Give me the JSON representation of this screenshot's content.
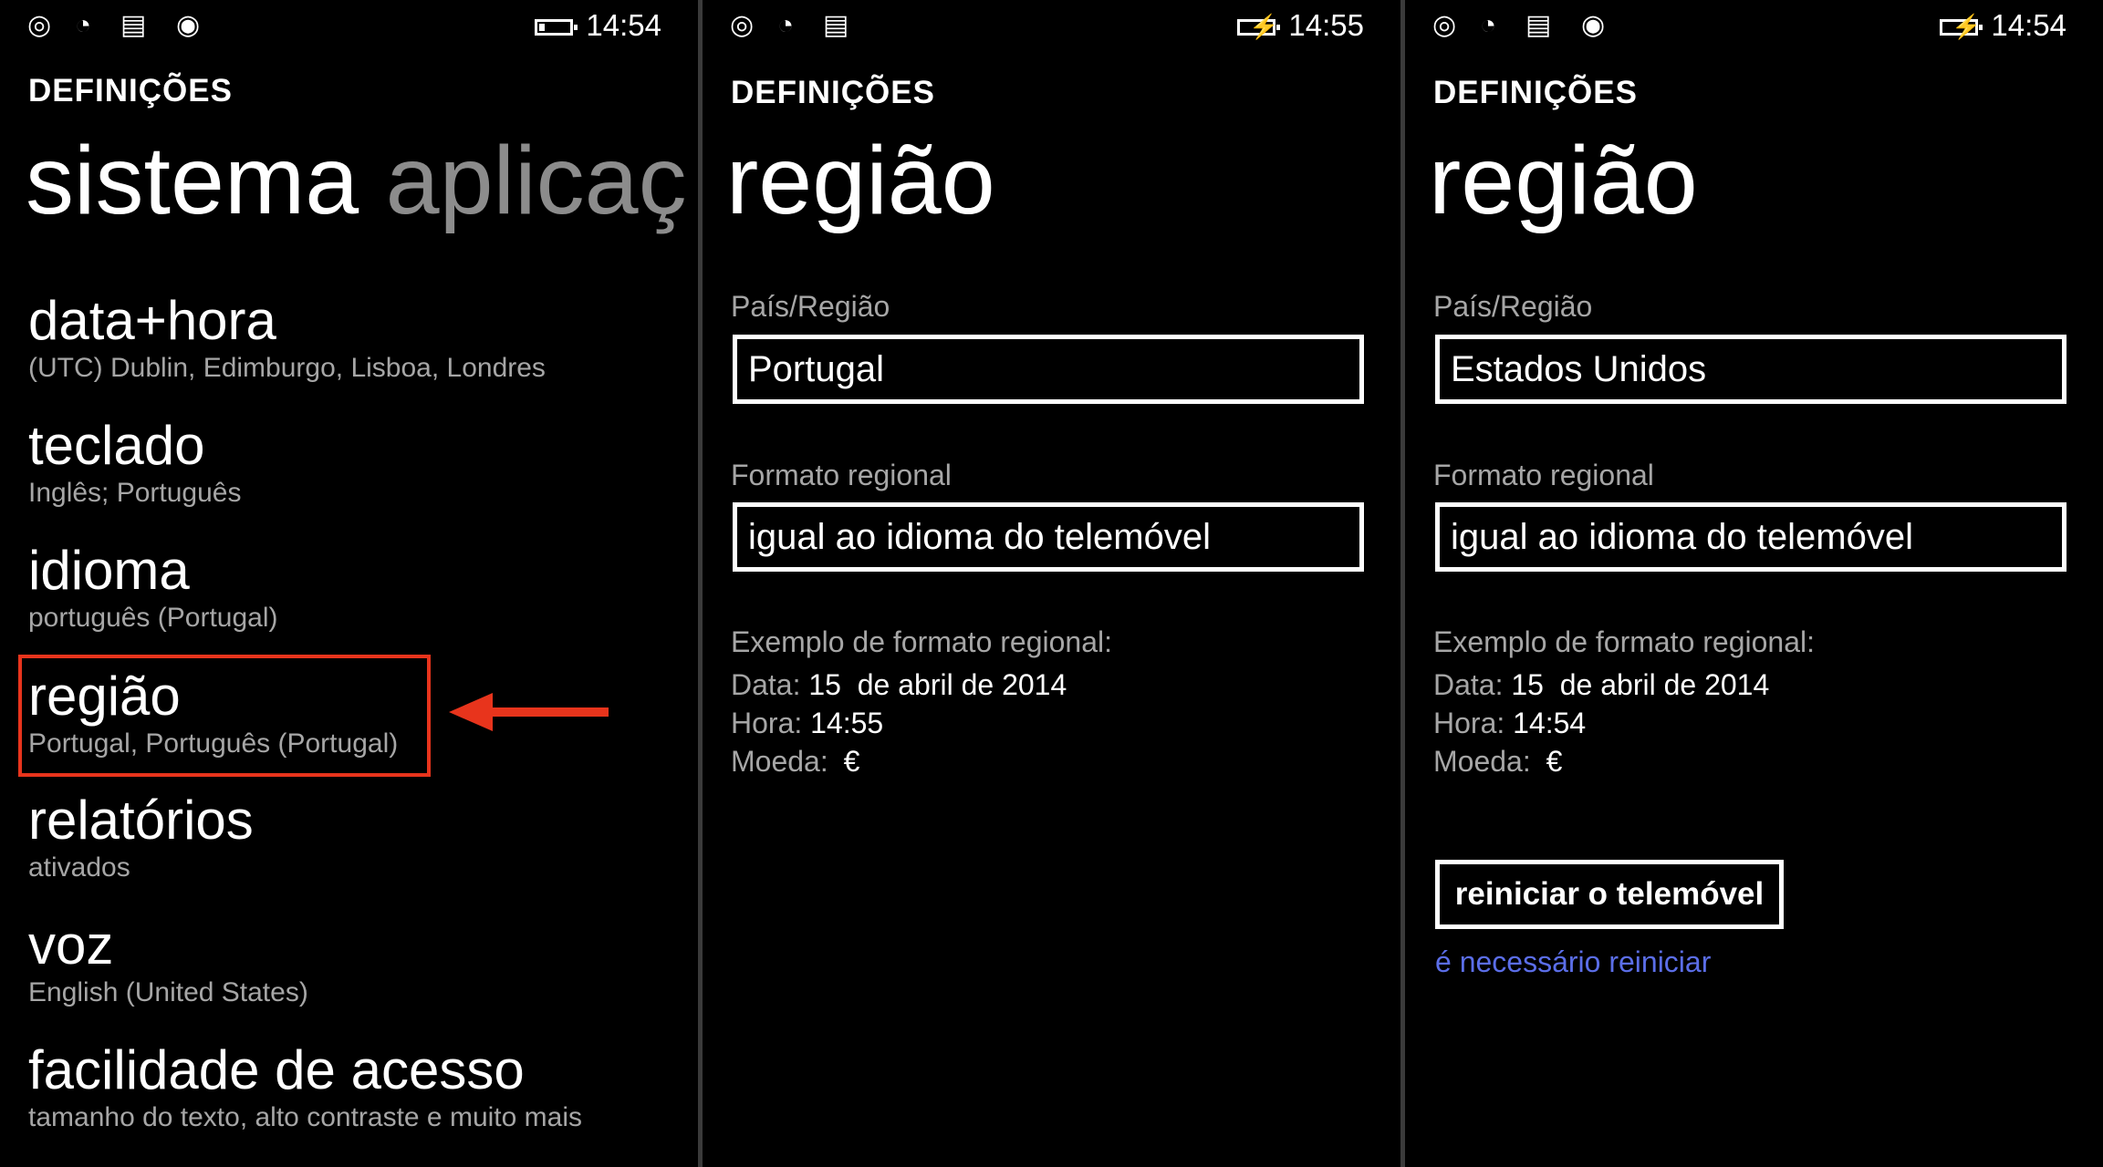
{
  "colors": {
    "background": "#000000",
    "accent_highlight": "#e8341c",
    "link": "#5b6ee8",
    "secondary_text": "#a6a6a6"
  },
  "panels": [
    {
      "status": {
        "time": "14:54",
        "icons": [
          "signal-icon",
          "wifi-icon",
          "message-icon",
          "location-icon",
          "battery-icon"
        ]
      },
      "app_name": "DEFINIÇÕES",
      "title": "sistema",
      "title_next": "aplicaç",
      "items": [
        {
          "title": "data+hora",
          "subtitle": "(UTC) Dublin, Edimburgo, Lisboa, Londres"
        },
        {
          "title": "teclado",
          "subtitle": "Inglês; Português"
        },
        {
          "title": "idioma",
          "subtitle": "português (Portugal)"
        },
        {
          "title": "região",
          "subtitle": "Portugal, Português (Portugal)"
        },
        {
          "title": "relatórios",
          "subtitle": "ativados"
        },
        {
          "title": "voz",
          "subtitle": "English (United States)"
        },
        {
          "title": "facilidade de acesso",
          "subtitle": "tamanho do texto, alto contraste e muito mais"
        }
      ]
    },
    {
      "status": {
        "time": "14:55",
        "icons": [
          "signal-icon",
          "wifi-icon",
          "message-icon",
          "battery-charging-icon"
        ]
      },
      "app_name": "DEFINIÇÕES",
      "title": "região",
      "country_label": "País/Região",
      "country_value": "Portugal",
      "format_label": "Formato regional",
      "format_value": "igual ao idioma do telemóvel",
      "example_heading": "Exemplo de formato regional:",
      "date_label": "Data:",
      "date_value": "15  de abril de 2014",
      "time_label": "Hora:",
      "time_value": "14:55",
      "currency_label": "Moeda:",
      "currency_value": "€"
    },
    {
      "status": {
        "time": "14:54",
        "icons": [
          "signal-icon",
          "wifi-icon",
          "message-icon",
          "location-icon",
          "battery-charging-icon"
        ]
      },
      "app_name": "DEFINIÇÕES",
      "title": "região",
      "country_label": "País/Região",
      "country_value": "Estados Unidos",
      "format_label": "Formato regional",
      "format_value": "igual ao idioma do telemóvel",
      "example_heading": "Exemplo de formato regional:",
      "date_label": "Data:",
      "date_value": "15  de abril de 2014",
      "time_label": "Hora:",
      "time_value": "14:54",
      "currency_label": "Moeda:",
      "currency_value": "€",
      "restart_button": "reiniciar o telemóvel",
      "restart_note": "é necessário reiniciar"
    }
  ]
}
